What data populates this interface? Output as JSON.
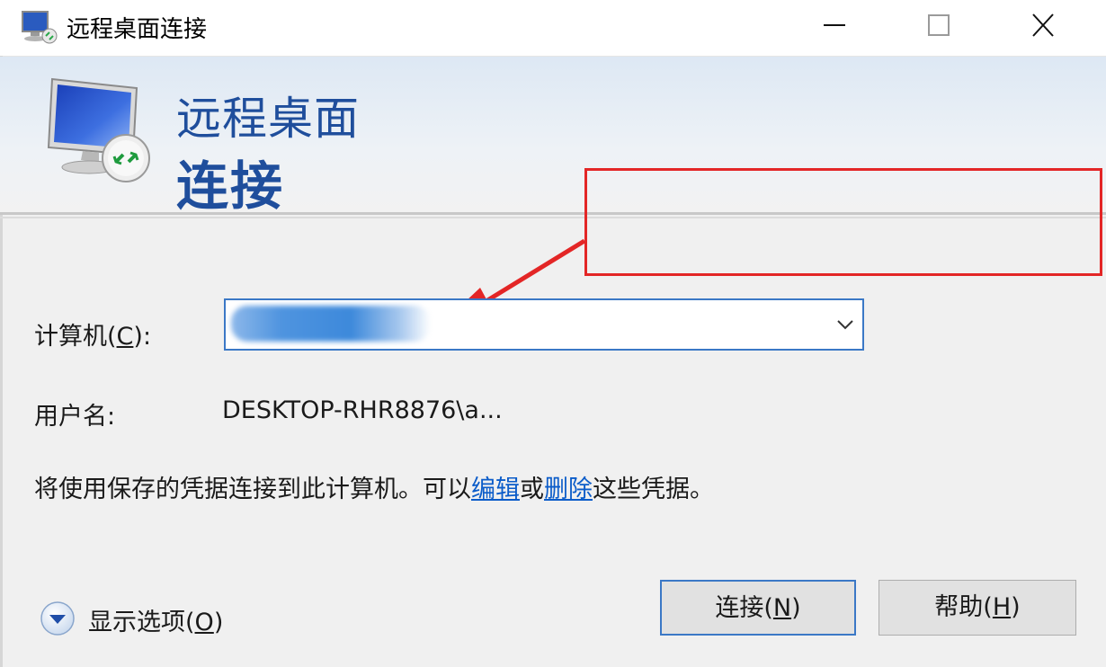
{
  "window": {
    "title": "远程桌面连接",
    "controls": [
      "minimize",
      "maximize",
      "close"
    ]
  },
  "banner": {
    "line1": "远程桌面",
    "line2": "连接"
  },
  "form": {
    "computer_label_pre": "计算机(",
    "computer_label_key": "C",
    "computer_label_post": "):",
    "computer_value_redacted": true,
    "username_label": "用户名:",
    "username_value": "DESKTOP-RHR8876\\a..."
  },
  "info": {
    "text_before": "将使用保存的凭据连接到此计算机。可以",
    "edit_link": "编辑",
    "text_or": "或",
    "delete_link": "删除",
    "text_after": "这些凭据。"
  },
  "options": {
    "label_pre": "显示选项(",
    "label_key": "O",
    "label_post": ")"
  },
  "buttons": {
    "connect_pre": "连接(",
    "connect_key": "N",
    "connect_post": ")",
    "help_pre": "帮助(",
    "help_key": "H",
    "help_post": ")"
  },
  "annotation": {
    "box_color": "#e32626",
    "arrow_color": "#e32626"
  },
  "colors": {
    "banner_text": "#1f4e9c",
    "link": "#0b5cc9",
    "focus_border": "#3b78c6"
  }
}
